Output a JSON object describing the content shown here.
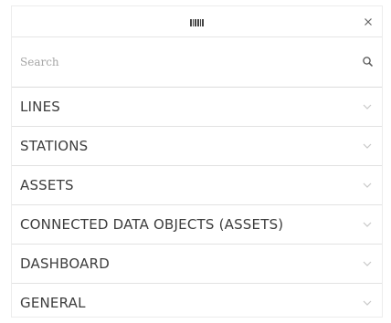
{
  "search": {
    "placeholder": "Search",
    "value": ""
  },
  "icons": {
    "drag_handle": "drag-handle-icon",
    "close": "close-icon",
    "search": "search-icon",
    "expand": "chevron-down-icon"
  },
  "menu": {
    "items": [
      {
        "label": "LINES",
        "expanded": false
      },
      {
        "label": "STATIONS",
        "expanded": false
      },
      {
        "label": "ASSETS",
        "expanded": false
      },
      {
        "label": "CONNECTED DATA OBJECTS (ASSETS)",
        "expanded": false
      },
      {
        "label": "DASHBOARD",
        "expanded": false
      },
      {
        "label": "GENERAL",
        "expanded": false
      }
    ]
  },
  "colors": {
    "text": "#3d3d3d",
    "placeholder": "#a6a6a6",
    "divider": "#e2e2e2",
    "chevron": "#c8c8c8"
  }
}
